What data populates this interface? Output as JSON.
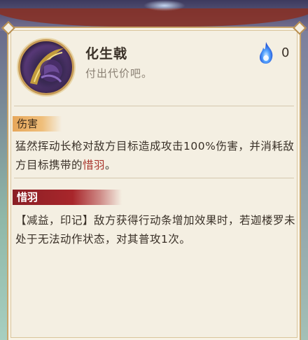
{
  "skill": {
    "name": "化生戟",
    "subtitle": "付出代价吧。",
    "cost_icon": "blue-soul-flame-icon",
    "cost": "0"
  },
  "damage_section": {
    "tag": "伤害",
    "description_prefix": "猛然挥动长枪对敌方目标造成攻击100%伤害，并消耗敌方目标携带的",
    "keyword": "惜羽",
    "description_suffix": "。"
  },
  "cherish_section": {
    "tag": "惜羽",
    "description": "【减益，印记】敌方获得行动条增加效果时，若迦楼罗未处于无法动作状态，对其普攻1次。"
  },
  "colors": {
    "highlight": "#a8332a",
    "damage_tag": "#e7a75a",
    "cherish_tag": "#a8262b",
    "panel": "#f4efe2"
  }
}
